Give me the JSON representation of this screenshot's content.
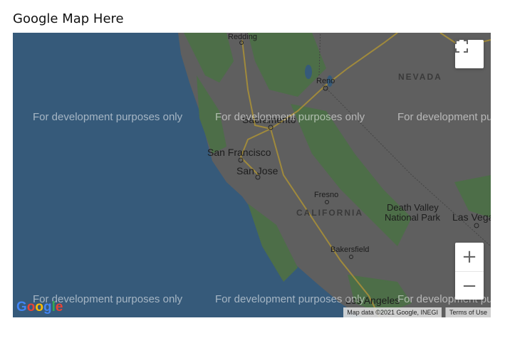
{
  "page_title": "Google Map Here",
  "map": {
    "cities": [
      "Redding",
      "Reno",
      "Sacramento",
      "San Francisco",
      "San Jose",
      "Fresno",
      "Bakersfield",
      "Death Valley",
      "National Park",
      "Las Vegas",
      "Los Angeles"
    ],
    "states": [
      "NEVADA",
      "CALIFORNIA"
    ],
    "watermark": "For development purposes only",
    "attribution": "Map data ©2021 Google, INEGI",
    "terms": "Terms of Use",
    "logo": "Google",
    "colors": {
      "ocean": "#365a7a",
      "land": "#5f5f5f",
      "forest": "#4d6e48",
      "road": "#a08a3c"
    },
    "controls": {
      "fullscreen": "fullscreen-icon",
      "zoom_in": "+",
      "zoom_out": "−"
    }
  }
}
